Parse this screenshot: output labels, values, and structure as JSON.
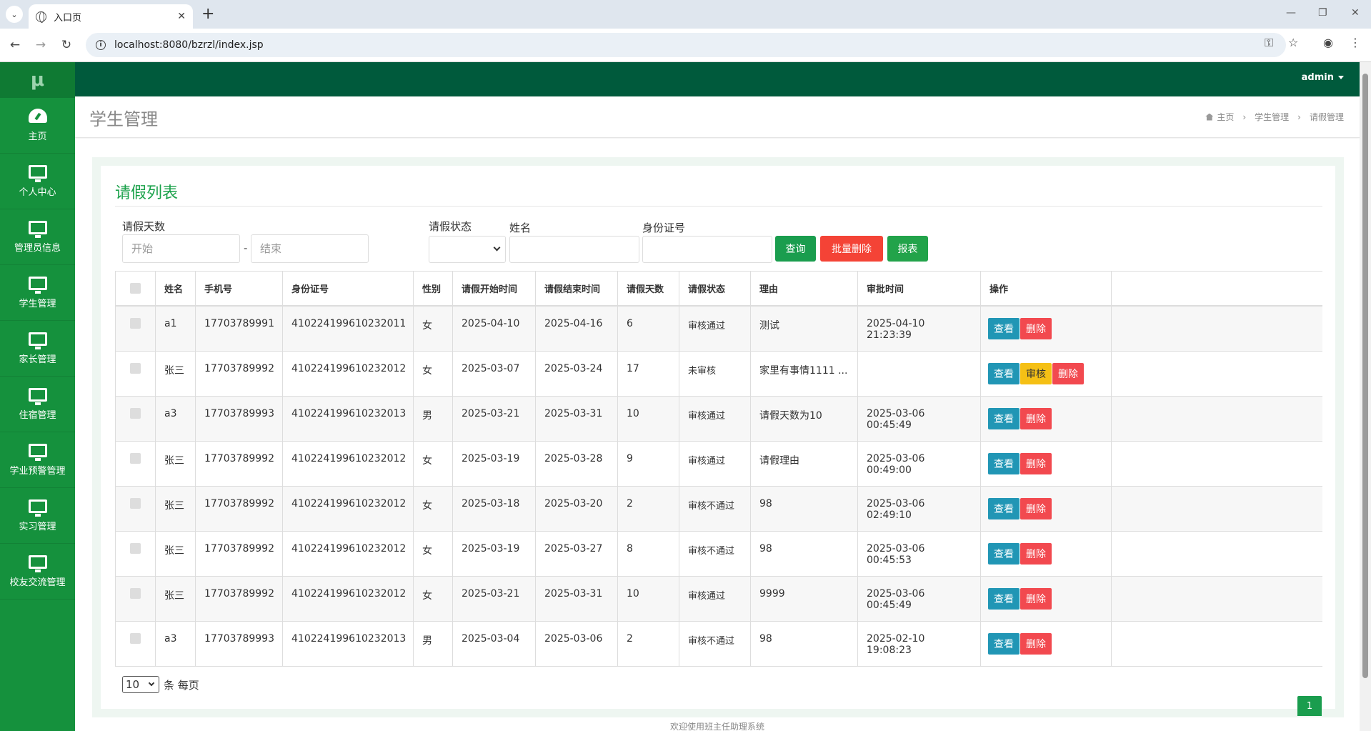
{
  "browser": {
    "tab_title": "入口页",
    "url": "localhost:8080/bzrzl/index.jsp"
  },
  "sidebar": {
    "logo": "μ",
    "items": [
      {
        "label": "主页",
        "icon": "dashboard-icon"
      },
      {
        "label": "个人中心",
        "icon": "monitor-icon"
      },
      {
        "label": "管理员信息",
        "icon": "monitor-icon"
      },
      {
        "label": "学生管理",
        "icon": "monitor-icon"
      },
      {
        "label": "家长管理",
        "icon": "monitor-icon"
      },
      {
        "label": "住宿管理",
        "icon": "monitor-icon"
      },
      {
        "label": "学业预警管理",
        "icon": "monitor-icon"
      },
      {
        "label": "实习管理",
        "icon": "monitor-icon"
      },
      {
        "label": "校友交流管理",
        "icon": "monitor-icon"
      }
    ]
  },
  "header": {
    "user": "admin"
  },
  "page": {
    "title": "学生管理",
    "breadcrumb": [
      "主页",
      "学生管理",
      "请假管理"
    ]
  },
  "panel": {
    "title": "请假列表"
  },
  "filters": {
    "days_label": "请假天数",
    "start_placeholder": "开始",
    "dash": "-",
    "end_placeholder": "结束",
    "status_label": "请假状态",
    "name_label": "姓名",
    "idcard_label": "身份证号",
    "query_btn": "查询",
    "batch_delete_btn": "批量删除",
    "report_btn": "报表"
  },
  "colors": {
    "sidebar": "#15913d",
    "topbar": "#005a3c",
    "query": "#1a9d4e",
    "batch_delete": "#f44336",
    "report": "#22a34a",
    "view": "#2196b5",
    "delete": "#f2494f",
    "audit": "#f5c015"
  },
  "table": {
    "headers": [
      "姓名",
      "手机号",
      "身份证号",
      "性别",
      "请假开始时间",
      "请假结束时间",
      "请假天数",
      "请假状态",
      "理由",
      "审批时间",
      "操作"
    ],
    "rows": [
      {
        "name": "a1",
        "phone": "17703789991",
        "idcard": "410224199610232011",
        "gender": "女",
        "start": "2025-04-10",
        "end": "2025-04-16",
        "days": "6",
        "status": "审核通过",
        "reason": "测试",
        "approved": "2025-04-10 21:23:39",
        "audit": false
      },
      {
        "name": "张三",
        "phone": "17703789992",
        "idcard": "410224199610232012",
        "gender": "女",
        "start": "2025-03-07",
        "end": "2025-03-24",
        "days": "17",
        "status": "未审核",
        "reason": "家里有事情1111 ...",
        "approved": "",
        "audit": true
      },
      {
        "name": "a3",
        "phone": "17703789993",
        "idcard": "410224199610232013",
        "gender": "男",
        "start": "2025-03-21",
        "end": "2025-03-31",
        "days": "10",
        "status": "审核通过",
        "reason": "请假天数为10",
        "approved": "2025-03-06 00:45:49",
        "audit": false
      },
      {
        "name": "张三",
        "phone": "17703789992",
        "idcard": "410224199610232012",
        "gender": "女",
        "start": "2025-03-19",
        "end": "2025-03-28",
        "days": "9",
        "status": "审核通过",
        "reason": "请假理由",
        "approved": "2025-03-06 00:49:00",
        "audit": false
      },
      {
        "name": "张三",
        "phone": "17703789992",
        "idcard": "410224199610232012",
        "gender": "女",
        "start": "2025-03-18",
        "end": "2025-03-20",
        "days": "2",
        "status": "审核不通过",
        "reason": "98",
        "approved": "2025-03-06 02:49:10",
        "audit": false
      },
      {
        "name": "张三",
        "phone": "17703789992",
        "idcard": "410224199610232012",
        "gender": "女",
        "start": "2025-03-19",
        "end": "2025-03-27",
        "days": "8",
        "status": "审核不通过",
        "reason": "98",
        "approved": "2025-03-06 00:45:53",
        "audit": false
      },
      {
        "name": "张三",
        "phone": "17703789992",
        "idcard": "410224199610232012",
        "gender": "女",
        "start": "2025-03-21",
        "end": "2025-03-31",
        "days": "10",
        "status": "审核通过",
        "reason": "9999",
        "approved": "2025-03-06 00:45:49",
        "audit": false
      },
      {
        "name": "a3",
        "phone": "17703789993",
        "idcard": "410224199610232013",
        "gender": "男",
        "start": "2025-03-04",
        "end": "2025-03-06",
        "days": "2",
        "status": "审核不通过",
        "reason": "98",
        "approved": "2025-02-10 19:08:23",
        "audit": false
      }
    ],
    "actions": {
      "view": "查看",
      "audit": "审核",
      "delete": "删除"
    }
  },
  "pagination": {
    "page_size": "10",
    "suffix": "条 每页",
    "current_page": "1"
  },
  "footer": "欢迎使用班主任助理系统"
}
